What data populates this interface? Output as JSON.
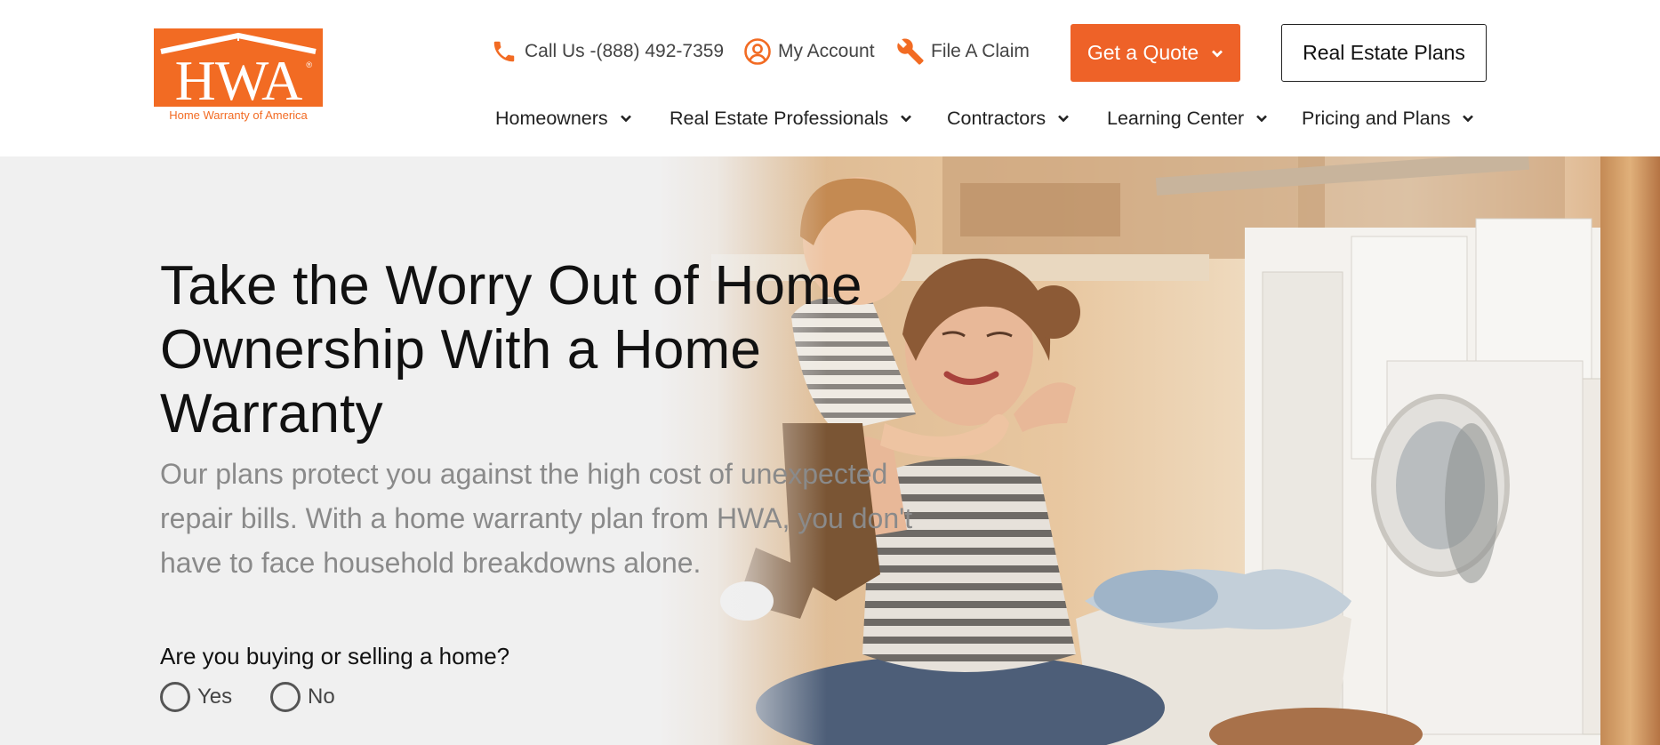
{
  "brand": {
    "logo_letters": "HWA",
    "registered_mark": "®",
    "tagline": "Home Warranty of America",
    "accent_color": "#f26b23"
  },
  "utility_nav": {
    "call": {
      "label": "Call Us -(888) 492-7359",
      "icon": "phone-icon"
    },
    "account": {
      "label": "My Account",
      "icon": "user-circle-icon"
    },
    "claim": {
      "label": "File A Claim",
      "icon": "wrench-icon"
    },
    "quote_button": {
      "label": "Get a Quote",
      "icon": "chevron-down-icon",
      "color": "#ee6228"
    },
    "real_estate_button": {
      "label": "Real Estate Plans"
    }
  },
  "main_nav": [
    {
      "label": "Homeowners"
    },
    {
      "label": "Real Estate Professionals"
    },
    {
      "label": "Contractors"
    },
    {
      "label": "Learning Center"
    },
    {
      "label": "Pricing and Plans"
    }
  ],
  "hero": {
    "title": "Take the Worry Out of Home Ownership With a Home Warranty",
    "subtitle": "Our plans protect you against the high cost of unexpected repair bills. With a home warranty plan from HWA, you don't have to face household breakdowns alone.",
    "question": "Are you buying or selling a home?",
    "options": [
      {
        "label": "Yes",
        "selected": false
      },
      {
        "label": "No",
        "selected": false
      }
    ]
  }
}
